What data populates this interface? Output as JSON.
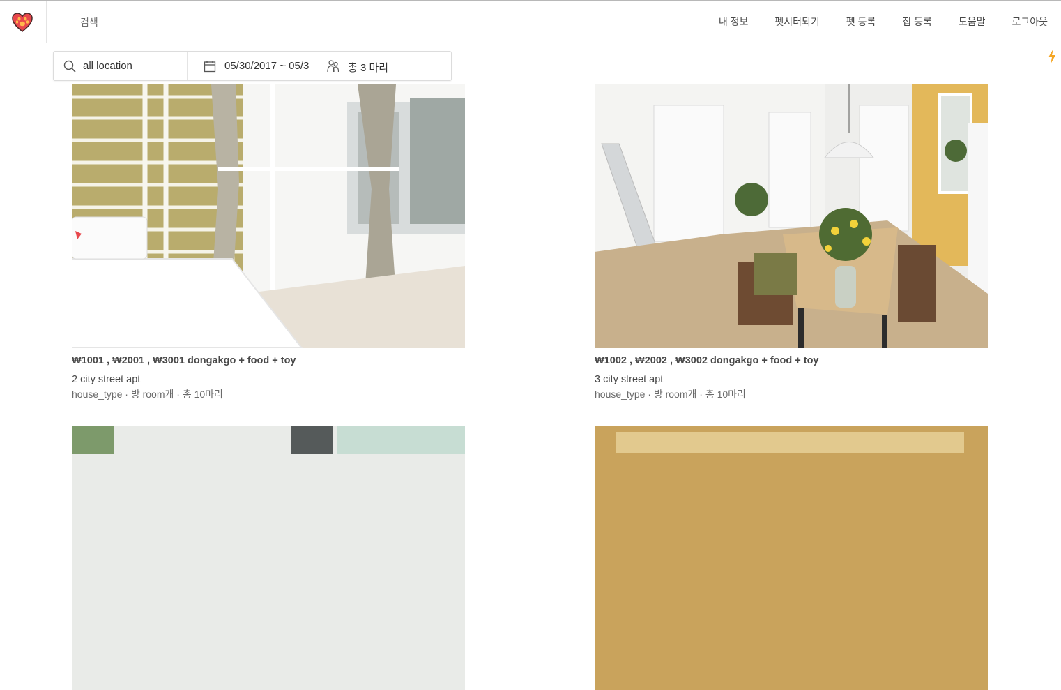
{
  "header": {
    "search_label": "검색",
    "nav": [
      "내 정보",
      "펫시터되기",
      "펫 등록",
      "집 등록",
      "도움말",
      "로그아웃"
    ]
  },
  "searchbar": {
    "location": "all location",
    "dates": "05/30/2017 ~ 05/3",
    "guests": "총 3 마리"
  },
  "listings": [
    {
      "price": "₩1001 , ₩2001 , ₩3001 dongakgo + food + toy",
      "address": "2 city street apt",
      "meta": "house_type · 방 room개 · 총 10마리"
    },
    {
      "price": "₩1002 , ₩2002 , ₩3002 dongakgo + food + toy",
      "address": "3 city street apt",
      "meta": "house_type · 방 room개 · 총 10마리"
    }
  ],
  "colors": {
    "brand": "#e8474c",
    "bolt": "#f5a623"
  },
  "icons": [
    "paw-heart-logo-icon",
    "search-icon",
    "calendar-icon",
    "pets-icon",
    "lightning-icon"
  ]
}
